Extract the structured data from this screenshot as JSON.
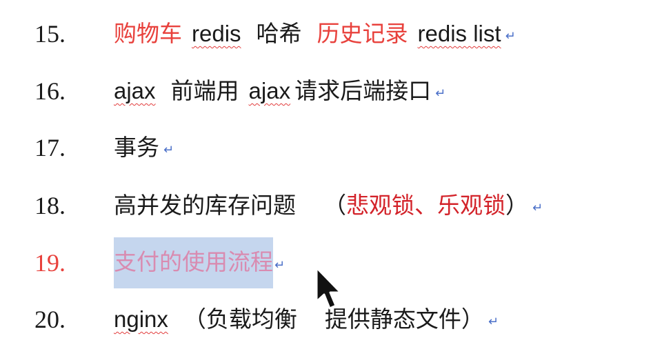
{
  "items": [
    {
      "number": "15.",
      "segments": [
        {
          "text": "购物车",
          "style": "red"
        },
        {
          "text": "redis",
          "style": "latin-spell"
        },
        {
          "text": "哈希",
          "style": "normal"
        },
        {
          "text": "历史记录",
          "style": "red"
        },
        {
          "text": "redis list",
          "style": "latin-spell"
        }
      ]
    },
    {
      "number": "16.",
      "segments": [
        {
          "text": "ajax",
          "style": "latin-spell"
        },
        {
          "text": "前端用",
          "style": "normal"
        },
        {
          "text": "ajax",
          "style": "latin-spell"
        },
        {
          "text": "请求后端接口",
          "style": "normal"
        }
      ]
    },
    {
      "number": "17.",
      "segments": [
        {
          "text": "事务",
          "style": "normal"
        }
      ]
    },
    {
      "number": "18.",
      "segments": [
        {
          "text": "高并发的库存问题",
          "style": "normal"
        },
        {
          "text": "（",
          "style": "normal"
        },
        {
          "text": "悲观锁、乐观锁",
          "style": "dark-red"
        },
        {
          "text": "）",
          "style": "normal"
        }
      ]
    },
    {
      "number": "19.",
      "segments": [
        {
          "text": "支付的使用流程",
          "style": "selected"
        }
      ]
    },
    {
      "number": "20.",
      "segments": [
        {
          "text": "nginx",
          "style": "latin-spell"
        },
        {
          "text": "（负载均衡",
          "style": "normal"
        },
        {
          "text": "提供静态文件）",
          "style": "normal"
        }
      ]
    }
  ],
  "paragraph_mark": "↵",
  "colors": {
    "red_text": "#e8413c",
    "dark_red_text": "#d3232a",
    "selection_bg": "#c5d6ee",
    "selected_text": "#d98bb0",
    "paragraph_mark": "#4a6fc8",
    "spellcheck_underline": "#e23b3b"
  },
  "cursor_icon": "arrow-pointer-icon"
}
